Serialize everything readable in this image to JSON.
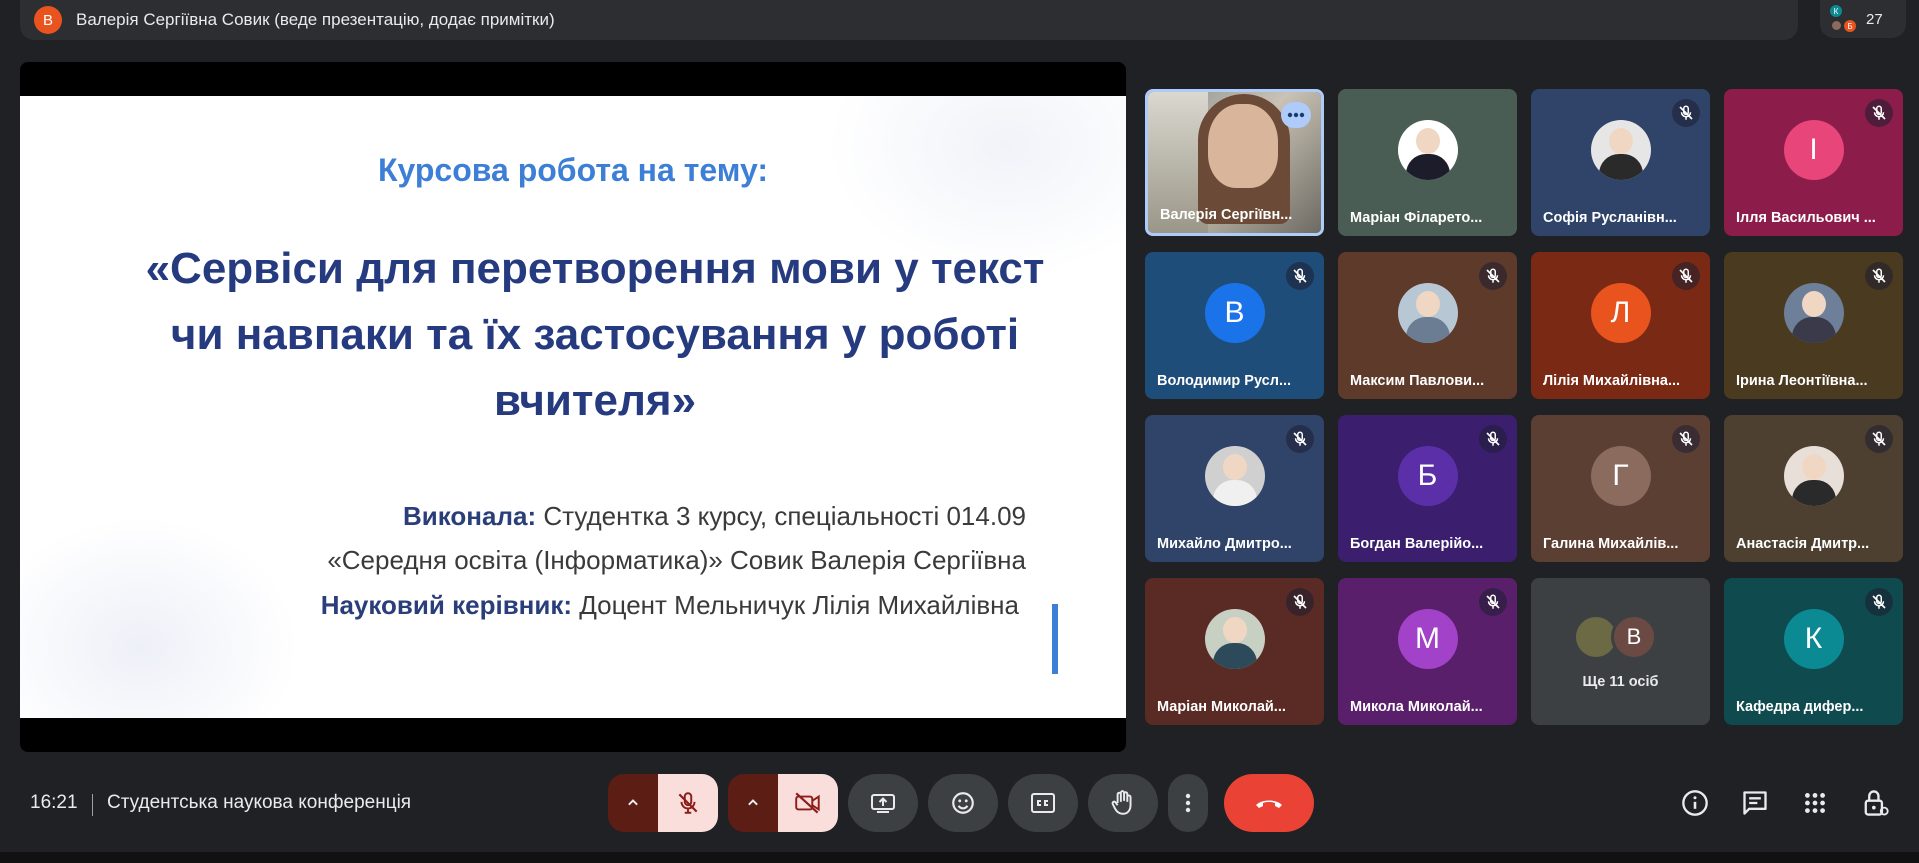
{
  "presenter": {
    "avatar_letter": "В",
    "text": "Валерія Сергіївна Совик (веде презентацію, додає примітки)"
  },
  "participants": {
    "count": "27",
    "mini_avatars": [
      "К",
      "Б"
    ]
  },
  "slide": {
    "subtitle": "Курсова робота на тему:",
    "title_lines": [
      "«Сервіси для перетворення мови у текст",
      "чи навпаки та їх застосування у роботі",
      "вчителя»"
    ],
    "author_label": "Виконала:",
    "author_line1": " Студентка 3 курсу, спеціальності 014.09",
    "author_line2": "«Середня освіта (Інформатика)» Совик Валерія Сергіївна",
    "supervisor_label": "Науковий керівник:",
    "supervisor_value": " Доцент Мельничук Лілія Михайлівна"
  },
  "tiles": [
    {
      "name": "Валерія Сергіївн...",
      "kind": "video",
      "active": true,
      "muted": false
    },
    {
      "name": "Маріан Філарето...",
      "kind": "photo",
      "bg": "#4a5d55",
      "avatar_bg": "#ffffff",
      "body": "#1c1c2a",
      "muted": false
    },
    {
      "name": "Софія Русланівн...",
      "kind": "photo",
      "bg": "#2f4468",
      "avatar_bg": "#e6e6e6",
      "body": "#2a2a2a",
      "muted": true
    },
    {
      "name": "Ілля Васильович ...",
      "kind": "letter",
      "letter": "І",
      "bg": "#8c1d4a",
      "avatar_bg": "#e8457a",
      "muted": true
    },
    {
      "name": "Володимир Русл...",
      "kind": "letter",
      "letter": "В",
      "bg": "#1f4d7a",
      "avatar_bg": "#1a73e8",
      "muted": true
    },
    {
      "name": "Максим Павлови...",
      "kind": "photo",
      "bg": "#5e3a2a",
      "avatar_bg": "#b8c7d4",
      "body": "#6a7d92",
      "muted": true
    },
    {
      "name": "Лілія Михайлівна...",
      "kind": "letter",
      "letter": "Л",
      "bg": "#7a2a14",
      "avatar_bg": "#e8531e",
      "muted": true
    },
    {
      "name": "Ірина Леонтіївна...",
      "kind": "photo",
      "bg": "#4a3a1f",
      "avatar_bg": "#6e7f9a",
      "body": "#3a3a4a",
      "muted": true
    },
    {
      "name": "Михайло Дмитро...",
      "kind": "photo",
      "bg": "#2f4468",
      "avatar_bg": "#d0d0d0",
      "body": "#f0f0f0",
      "muted": true
    },
    {
      "name": "Богдан Валерійо...",
      "kind": "letter",
      "letter": "Б",
      "bg": "#3b1f6e",
      "avatar_bg": "#5b2fa8",
      "muted": true
    },
    {
      "name": "Галина Михайлів...",
      "kind": "letter",
      "letter": "Г",
      "bg": "#5c3f33",
      "avatar_bg": "#8a6b5e",
      "muted": true
    },
    {
      "name": "Анастасія Дмитр...",
      "kind": "photo",
      "bg": "#4d4030",
      "avatar_bg": "#e8e0d8",
      "body": "#2a2a2a",
      "muted": true
    },
    {
      "name": "Маріан Миколай...",
      "kind": "photo",
      "bg": "#5a2a24",
      "avatar_bg": "#c8d0c4",
      "body": "#2d4a5a",
      "muted": true
    },
    {
      "name": "Микола Миколай...",
      "kind": "letter",
      "letter": "М",
      "bg": "#5a1f6a",
      "avatar_bg": "#a142c8",
      "muted": true
    },
    {
      "name": "Ще 11 осіб",
      "kind": "more",
      "bg": "#3c4043",
      "muted": false
    },
    {
      "name": "Кафедра дифер...",
      "kind": "letter",
      "letter": "К",
      "bg": "#0f4a4f",
      "avatar_bg": "#0b8a94",
      "muted": true
    }
  ],
  "more_tile": {
    "letter": "В"
  },
  "bottom": {
    "time": "16:21",
    "meeting_name": "Студентська наукова конференція"
  },
  "colors": {
    "end_call": "#ea4335",
    "muted_ctrl_bg": "#f9dedc",
    "muted_ctrl_icon": "#8c1d18",
    "accent": "#3d7fd6"
  },
  "icons": [
    "chevron-up-icon",
    "mic-off-icon",
    "camera-off-icon",
    "present-icon",
    "emoji-icon",
    "captions-icon",
    "raise-hand-icon",
    "more-vert-icon",
    "end-call-icon",
    "info-icon",
    "chat-icon",
    "apps-icon",
    "host-controls-icon"
  ]
}
